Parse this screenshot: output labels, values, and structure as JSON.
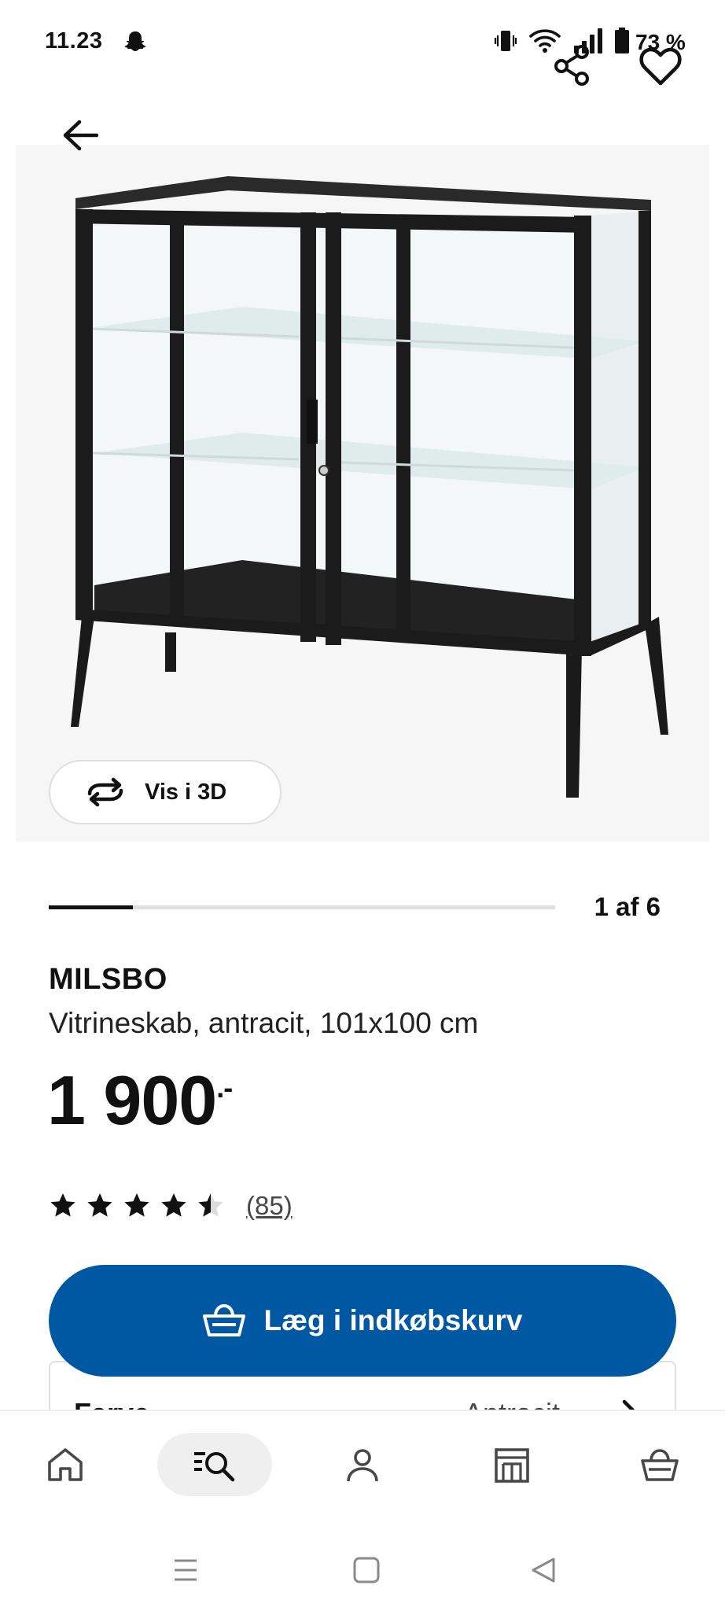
{
  "status_bar": {
    "time": "11.23",
    "battery_percent": "73 %",
    "icons": [
      "snapchat-icon",
      "vibrate-icon",
      "wifi-icon",
      "signal-icon",
      "battery-icon"
    ]
  },
  "header": {
    "icons": [
      "back-arrow-icon",
      "share-icon",
      "heart-icon"
    ]
  },
  "gallery": {
    "view_3d_label": "Vis i 3D",
    "page_counter": "1 af 6",
    "current_page": 1,
    "total_pages": 6
  },
  "product": {
    "name": "MILSBO",
    "description": "Vitrineskab, antracit, 101x100 cm",
    "price": "1 900",
    "price_suffix": ".-",
    "rating": 4.5,
    "rating_max": 5,
    "review_count": "(85)"
  },
  "actions": {
    "add_to_cart_label": "Læg i indkøbskurv"
  },
  "color_selector": {
    "label": "Farve",
    "value": "Antracit"
  },
  "bottom_nav": {
    "items": [
      "home",
      "search",
      "profile",
      "store",
      "basket"
    ],
    "active": "search"
  },
  "colors": {
    "brand_blue": "#0058a3",
    "text_dark": "#111111",
    "track_gray": "#dfdfdf"
  }
}
